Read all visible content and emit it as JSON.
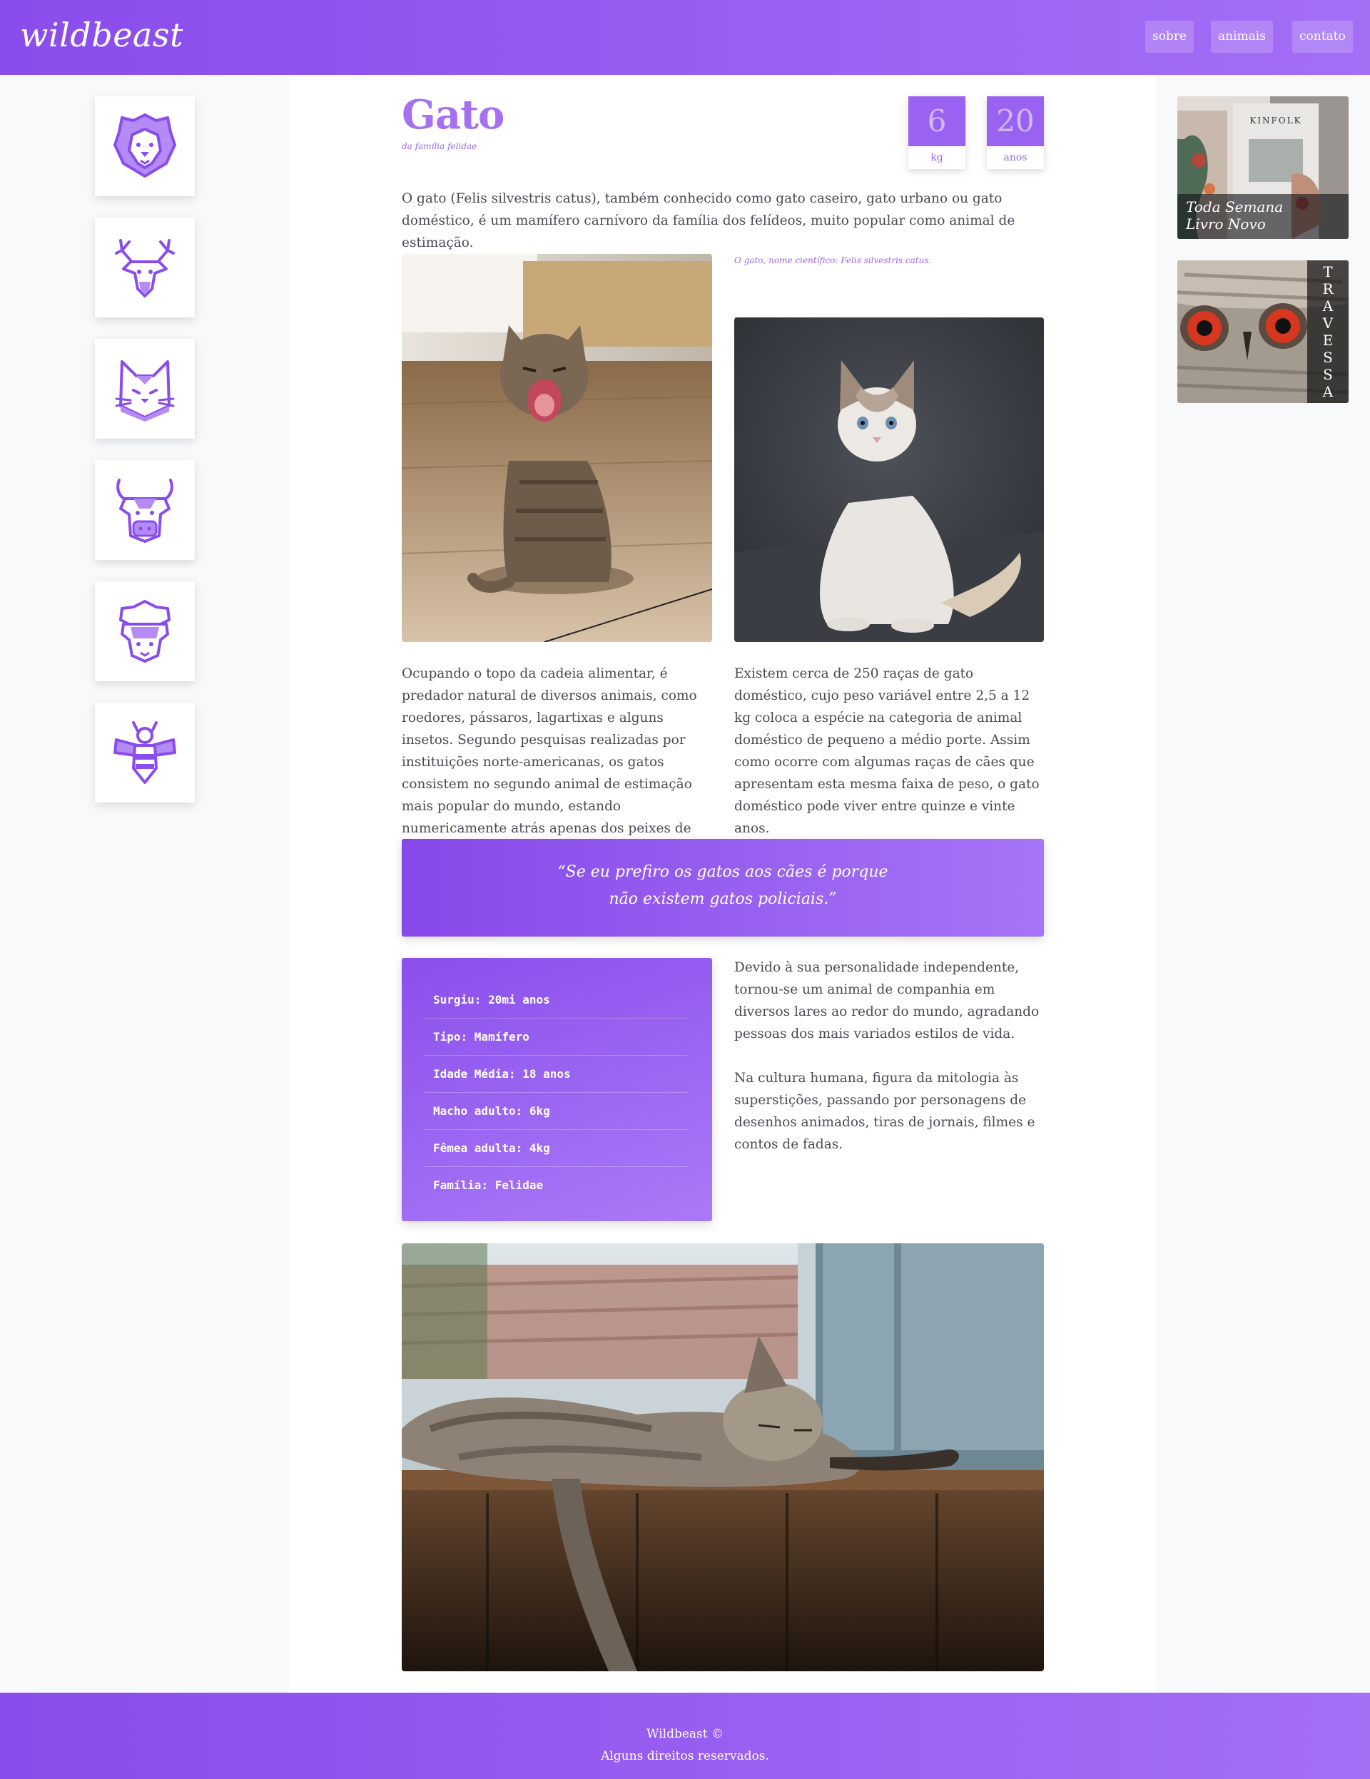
{
  "header": {
    "logo": "wildbeast",
    "nav": [
      {
        "label": "sobre"
      },
      {
        "label": "animais"
      },
      {
        "label": "contato"
      }
    ]
  },
  "sidebar": {
    "icons": [
      {
        "name": "lion-icon"
      },
      {
        "name": "deer-icon"
      },
      {
        "name": "cat-icon"
      },
      {
        "name": "bull-icon"
      },
      {
        "name": "sheep-icon"
      },
      {
        "name": "bee-icon"
      }
    ]
  },
  "article": {
    "title": "Gato",
    "subtitle": "da família felidae",
    "stats": [
      {
        "value": "6",
        "unit": "kg"
      },
      {
        "value": "20",
        "unit": "anos"
      }
    ],
    "intro": "O gato (Felis silvestris catus), também conhecido como gato caseiro, gato urbano ou gato doméstico, é um mamífero carnívoro da família dos felídeos, muito popular como animal de estimação.",
    "caption": "O gato, nome científico: Felis silvestris catus.",
    "para_left": "Ocupando o topo da cadeia alimentar, é predador natural de diversos animais, como roedores, pássaros, lagartixas e alguns insetos. Segundo pesquisas realizadas por instituições norte-americanas, os gatos consistem no segundo animal de estimação mais popular do mundo, estando numericamente atrás apenas dos peixes de aquário.",
    "para_right": "Existem cerca de 250 raças de gato doméstico, cujo peso variável entre 2,5 a 12 kg coloca a espécie na categoria de animal doméstico de pequeno a médio porte. Assim como ocorre com algumas raças de cães que apresentam esta mesma faixa de peso, o gato doméstico pode viver entre quinze e vinte anos.",
    "quote": "“Se eu prefiro os gatos aos cães é porque não existem gatos policiais.”",
    "facts": [
      "Surgiu: 20mi anos",
      "Tipo: Mamífero",
      "Idade Média: 18 anos",
      "Macho adulto: 6kg",
      "Fêmea adulta: 4kg",
      "Família: Felidae"
    ],
    "para_personality": "Devido à sua personalidade independente, tornou-se um animal de companhia em diversos lares ao redor do mundo, agradando pessoas dos mais variados estilos de vida.",
    "para_culture": "Na cultura humana, figura da mitologia às superstições, passando por personagens de desenhos animados, tiras de jornais, filmes e contos de fadas."
  },
  "ads": {
    "ad1_text_line1": "Toda Semana",
    "ad1_text_line2": "Livro Novo",
    "ad1_magazine": "KINFOLK",
    "ad2_letters": [
      "T",
      "R",
      "A",
      "V",
      "E",
      "S",
      "S",
      "A"
    ]
  },
  "footer": {
    "line1": "Wildbeast ©",
    "line2": "Alguns direitos reservados."
  },
  "colors": {
    "accent": "#9a62f1",
    "accent_dark": "#8748ea",
    "accent_light": "#a674f6"
  }
}
